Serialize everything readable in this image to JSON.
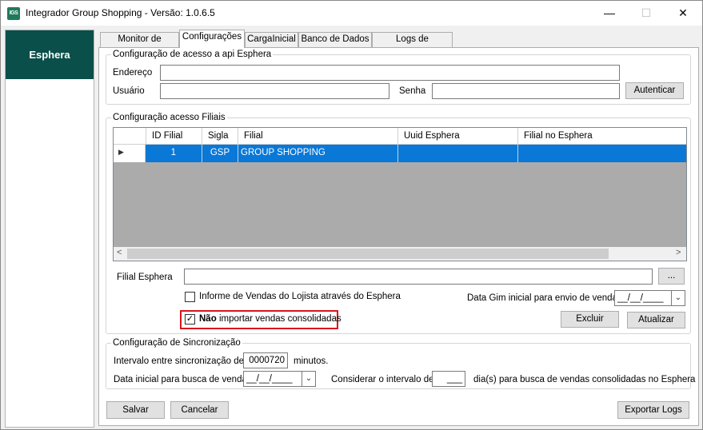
{
  "window": {
    "icon_text": "IGS",
    "title": "Integrador Group Shopping - Versão: 1.0.6.5",
    "minimize": "—",
    "maximize": "☐",
    "close": "✕"
  },
  "sidebar": {
    "items": [
      {
        "label": "Esphera"
      }
    ]
  },
  "tabs": [
    {
      "label": "Monitor de Serviço",
      "active": false
    },
    {
      "label": "Configurações",
      "active": true
    },
    {
      "label": "CargaInicial",
      "active": false
    },
    {
      "label": "Banco de Dados",
      "active": false
    },
    {
      "label": "Logs de Integração",
      "active": false
    }
  ],
  "api_group": {
    "title": "Configuração de acesso a api Esphera",
    "endereco_label": "Endereço",
    "endereco_value": "",
    "usuario_label": "Usuário",
    "usuario_value": "",
    "senha_label": "Senha",
    "senha_value": "",
    "auth_button": "Autenticar"
  },
  "filiais_group": {
    "title": "Configuração acesso Filiais",
    "columns": [
      "ID Filial",
      "Sigla",
      "Filial",
      "Uuid Esphera",
      "Filial no Esphera"
    ],
    "rows": [
      {
        "row_marker": "▶",
        "id": "1",
        "sigla": "GSP",
        "filial": "GROUP SHOPPING",
        "uuid": "",
        "filial_esphera": ""
      }
    ],
    "scroll_left": "<",
    "scroll_right": ">",
    "filial_esphera_label": "Filial Esphera",
    "filial_esphera_value": "",
    "browse_button": "...",
    "informe_label": "Informe de Vendas do Lojista através do Esphera",
    "informe_checked": false,
    "nao_importar_bold": "Não",
    "nao_importar_rest": "importar vendas consolidadas",
    "nao_importar_checked": true,
    "data_gim_label": "Data Gim inicial para envio de venda",
    "data_gim_value": "__/__/____",
    "excluir_button": "Excluir",
    "atualizar_button": "Atualizar"
  },
  "sync_group": {
    "title": "Configuração de Sincronização",
    "intervalo_label": "Intervalo entre sincronização de",
    "intervalo_value": "0000720",
    "minutos_label": "minutos.",
    "data_inicial_label": "Data inicial para busca de venda",
    "data_inicial_value": "__/__/____",
    "considerar_label": "Considerar o intervalo de",
    "considerar_value": "___",
    "dias_label": "dia(s) para busca de vendas consolidadas no Esphera"
  },
  "footer": {
    "salvar": "Salvar",
    "cancelar": "Cancelar",
    "exportar_logs": "Exportar Logs"
  },
  "colors": {
    "sidebar_active": "#0b4f4a",
    "selection": "#0a78d7",
    "highlight_border": "#d9141e"
  }
}
